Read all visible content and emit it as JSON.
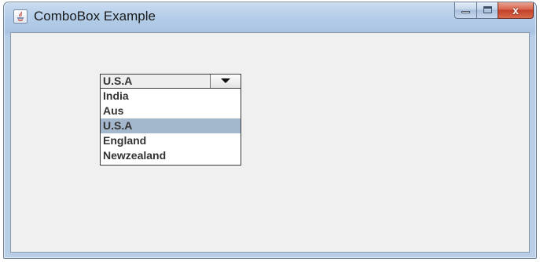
{
  "window": {
    "title": "ComboBox Example",
    "icon": "java-app-icon",
    "controls": {
      "minimize_icon": "minimize-icon",
      "maximize_icon": "maximize-icon",
      "close_symbol": "x",
      "close_color": "#c7442c"
    }
  },
  "combobox": {
    "selected_value": "U.S.A",
    "arrow_icon": "chevron-down-icon",
    "options": [
      "India",
      "Aus",
      "U.S.A",
      "England",
      "Newzealand"
    ],
    "highlighted_index": 2,
    "highlight_color": "#a3b8cc"
  }
}
